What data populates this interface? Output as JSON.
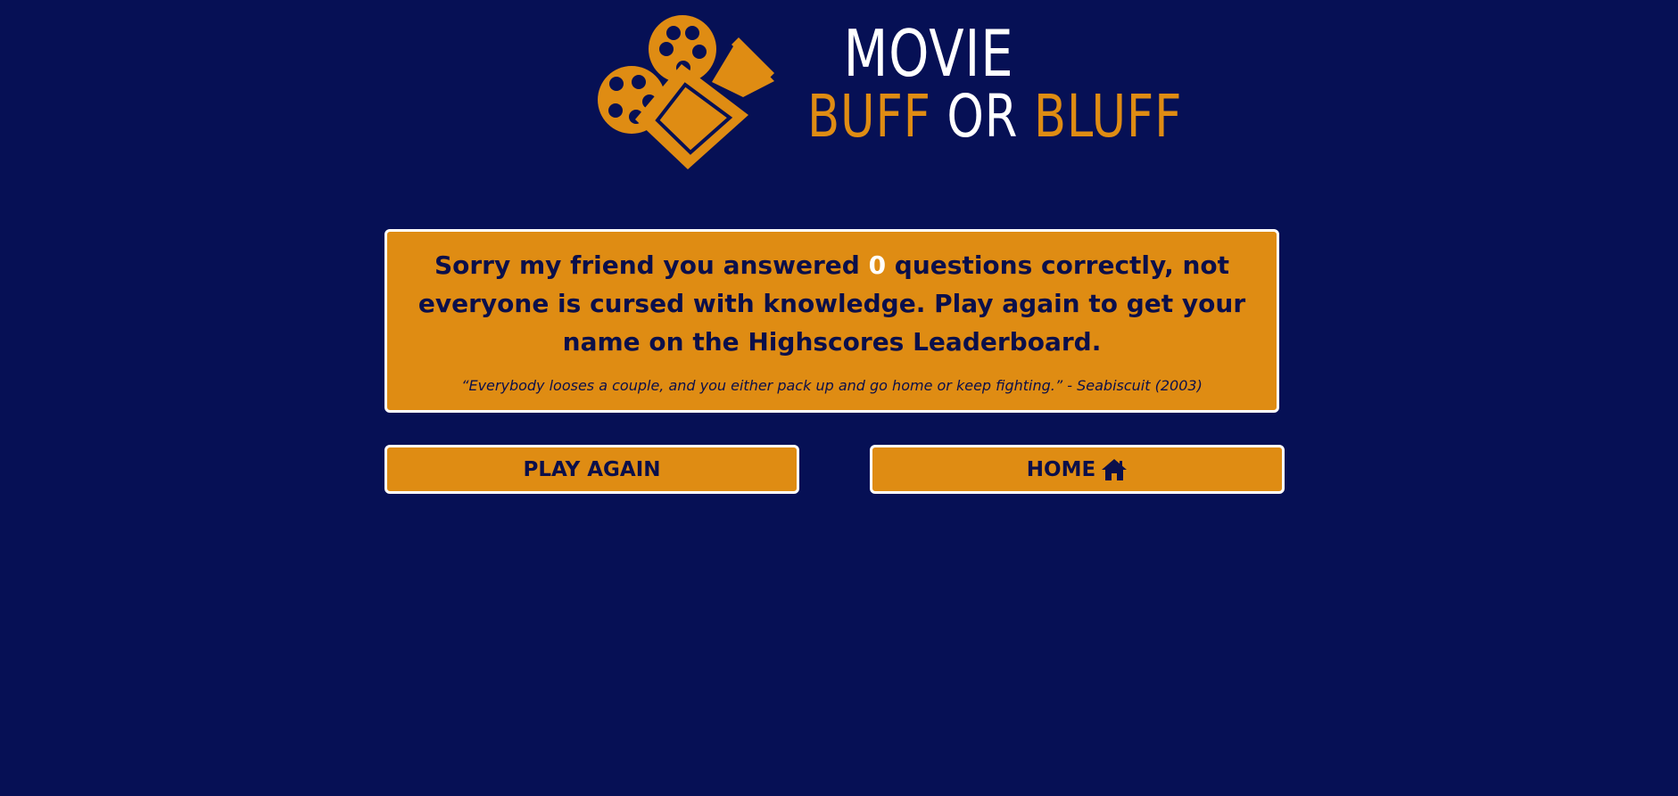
{
  "logo": {
    "line1": "MOVIE",
    "word_buff": "BUFF",
    "word_or": "OR",
    "word_bluff": "BLUFF",
    "icon": "film-camera-icon"
  },
  "result": {
    "message_before": "Sorry my friend you answered",
    "score": "0",
    "message_after": "questions correctly, not everyone is cursed with knowledge. Play again to get your name on the Highscores Leaderboard.",
    "quote": "“Everybody looses a couple, and you either pack up and go home or keep fighting.” - Seabiscuit (2003)"
  },
  "buttons": {
    "play_again": "PLAY AGAIN",
    "home": "HOME",
    "home_icon": "home-icon"
  },
  "colors": {
    "background": "#061055",
    "accent": "#df8c13",
    "text_dark": "#0b0f4a",
    "white": "#ffffff"
  }
}
